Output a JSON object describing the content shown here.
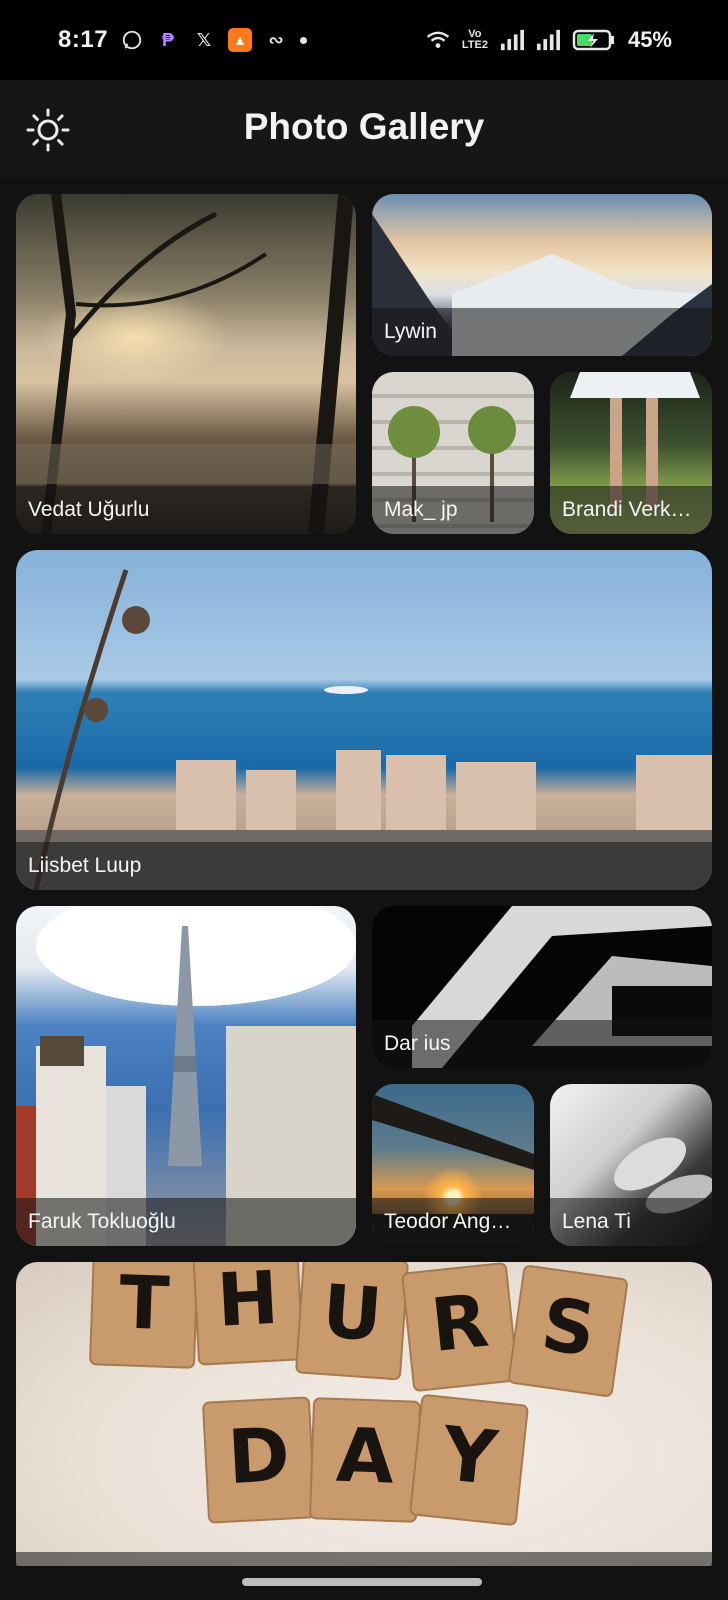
{
  "status_bar": {
    "time": "8:17",
    "battery": "45%",
    "lte_line1": "Vo",
    "lte_line2": "LTE2",
    "icons": [
      "whatsapp-icon",
      "phonepe-icon",
      "x-icon",
      "notification-app-icon",
      "link-icon",
      "dot-icon",
      "wifi-icon",
      "signal-icon",
      "signal-icon",
      "battery-charging-icon"
    ]
  },
  "app_bar": {
    "title": "Photo Gallery",
    "theme_icon": "sun-icon"
  },
  "gallery": [
    {
      "caption": "Vedat Uğurlu"
    },
    {
      "caption": "Lywin"
    },
    {
      "caption": "Mak_ jp"
    },
    {
      "caption": "Brandi Verk…"
    },
    {
      "caption": "Liisbet Luup"
    },
    {
      "caption": "Faruk Tokluoğlu"
    },
    {
      "caption": "Dar ius"
    },
    {
      "caption": "Teodor Ang…"
    },
    {
      "caption": "Lena Ti"
    },
    {
      "caption": "THURS DAY"
    }
  ],
  "colors": {
    "background": "#121212",
    "app_bar": "#161616",
    "status_bar": "#000000",
    "caption_overlay": "rgba(20,20,20,0.55)"
  }
}
